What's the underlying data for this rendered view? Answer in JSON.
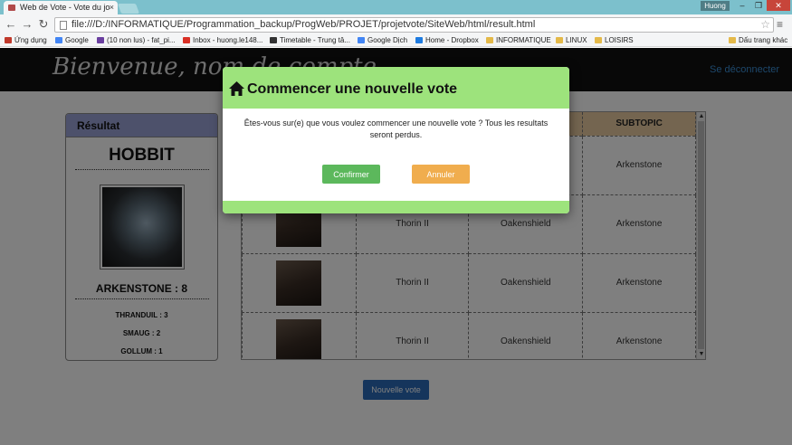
{
  "browser": {
    "tab_title": "Web de Vote - Vote du jo",
    "tab_close": "×",
    "user": "Huong",
    "window_min": "–",
    "window_max": "❐",
    "window_close": "✕",
    "url": "file:///D:/INFORMATIQUE/Programmation_backup/ProgWeb/PROJET/projetvote/SiteWeb/html/result.html",
    "back": "←",
    "forward": "→",
    "reload": "↻",
    "star": "☆",
    "menu": "≡",
    "bookmarks": [
      {
        "label": "Ứng dụng",
        "color": "#c0392b"
      },
      {
        "label": "Google",
        "color": "#4285f4"
      },
      {
        "label": "(10 non lus) - fat_pi...",
        "color": "#6a3fa0"
      },
      {
        "label": "Inbox - huong.le148...",
        "color": "#d93025"
      },
      {
        "label": "Timetable - Trung tâ...",
        "color": "#333333"
      },
      {
        "label": "Google Dịch",
        "color": "#4285f4"
      },
      {
        "label": "Home - Dropbox",
        "color": "#1e7be0"
      },
      {
        "label": "INFORMATIQUE",
        "color": "#e4b949"
      },
      {
        "label": "LINUX",
        "color": "#e4b949"
      },
      {
        "label": "LOISIRS",
        "color": "#e4b949"
      }
    ],
    "other_bookmarks": "Dấu trang khác"
  },
  "header": {
    "welcome": "Bienvenue, nom de compte",
    "logout": "Se déconnecter"
  },
  "result": {
    "heading": "Résultat",
    "winner_title": "HOBBIT",
    "winner_score": "ARKENSTONE : 8",
    "others": [
      "THRANDUIL : 3",
      "SMAUG : 2",
      "GOLLUM : 1"
    ]
  },
  "table": {
    "header_topic": "SUBTOPIC",
    "rows": [
      {
        "name": "",
        "title": "",
        "topic": "Arkenstone"
      },
      {
        "name": "Thorin II",
        "title": "Oakenshield",
        "topic": "Arkenstone"
      },
      {
        "name": "Thorin II",
        "title": "Oakenshield",
        "topic": "Arkenstone"
      },
      {
        "name": "Thorin II",
        "title": "Oakenshield",
        "topic": "Arkenstone"
      }
    ]
  },
  "new_vote_button": "Nouvelle vote",
  "modal": {
    "title": "Commencer une nouvelle vote",
    "message": "Êtes-vous sur(e) que vous voulez commencer une nouvelle vote ? Tous les resultats seront perdus.",
    "confirm": "Confirmer",
    "cancel": "Annuler"
  },
  "colors": {
    "modal_green": "#9de37c",
    "confirm_green": "#5cb85c",
    "cancel_orange": "#f0ad4e",
    "result_header": "#9ba3d6",
    "table_header": "#e8caa0",
    "primary_blue": "#2a6ab8"
  },
  "icons": [
    "home-icon",
    "star-icon",
    "menu-icon",
    "back-icon",
    "forward-icon",
    "reload-icon"
  ]
}
